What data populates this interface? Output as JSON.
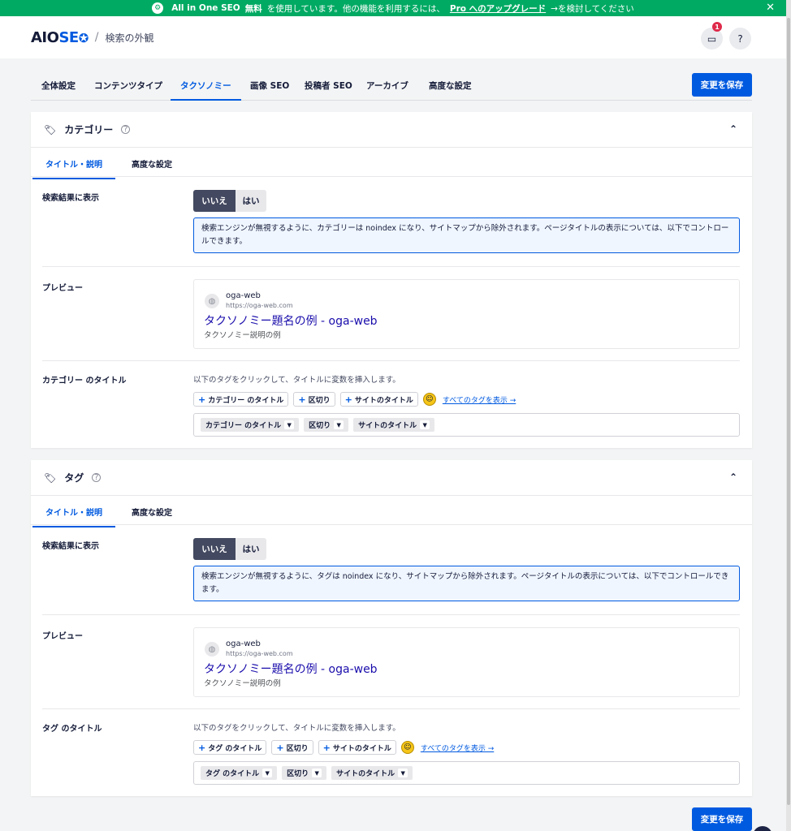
{
  "notice": {
    "brand": "All in One SEO",
    "free": "無料",
    "text1": "を使用しています。他の機能を利用するには、",
    "pro": "Pro",
    "upgrade": "へのアップグレード",
    "text2": "→を検討してください",
    "close": "✕"
  },
  "header": {
    "brand_aio": "AIO",
    "brand_seo": "SE",
    "breadcrumb_sep": "/",
    "breadcrumb": "検索の外観",
    "notification_count": "1"
  },
  "tabs": [
    "全体設定",
    "コンテンツタイプ",
    "タクソノミー",
    "画像 SEO",
    "投稿者 SEO",
    "アーカイブ",
    "高度な設定"
  ],
  "save_label": "変更を保存",
  "category": {
    "title": "カテゴリー",
    "subtabs": [
      "タイトル・説明",
      "高度な設定"
    ],
    "show_in_search_label": "検索結果に表示",
    "toggle_no": "いいえ",
    "toggle_yes": "はい",
    "info": "検索エンジンが無視するように、カテゴリーは noindex になり、サイトマップから除外されます。ページタイトルの表示については、以下でコントロールできます。",
    "preview_label": "プレビュー",
    "preview": {
      "site": "oga-web",
      "url": "https://oga-web.com",
      "title": "タクソノミー題名の例 - oga-web",
      "desc": "タクソノミー説明の例"
    },
    "title_label": "カテゴリー のタイトル",
    "hint": "以下のタグをクリックして、タイトルに変数を挿入します。",
    "chips": [
      "カテゴリー のタイトル",
      "区切り",
      "サイトのタイトル"
    ],
    "all_tags": "すべてのタグを表示 →",
    "tags": [
      "カテゴリー のタイトル",
      "区切り",
      "サイトのタイトル"
    ]
  },
  "tag": {
    "title": "タグ",
    "subtabs": [
      "タイトル・説明",
      "高度な設定"
    ],
    "show_in_search_label": "検索結果に表示",
    "toggle_no": "いいえ",
    "toggle_yes": "はい",
    "info": "検索エンジンが無視するように、タグは noindex になり、サイトマップから除外されます。ページタイトルの表示については、以下でコントロールできます。",
    "preview_label": "プレビュー",
    "preview": {
      "site": "oga-web",
      "url": "https://oga-web.com",
      "title": "タクソノミー題名の例 - oga-web",
      "desc": "タクソノミー説明の例"
    },
    "title_label": "タグ のタイトル",
    "hint": "以下のタグをクリックして、タイトルに変数を挿入します。",
    "chips": [
      "タグ のタイトル",
      "区切り",
      "サイトのタイトル"
    ],
    "all_tags": "すべてのタグを表示 →",
    "tags": [
      "タグ のタイトル",
      "区切り",
      "サイトのタイトル"
    ]
  },
  "colors": {
    "accent": "#005ae0",
    "notice_bg": "#00aa63",
    "dark": "#141b38"
  }
}
